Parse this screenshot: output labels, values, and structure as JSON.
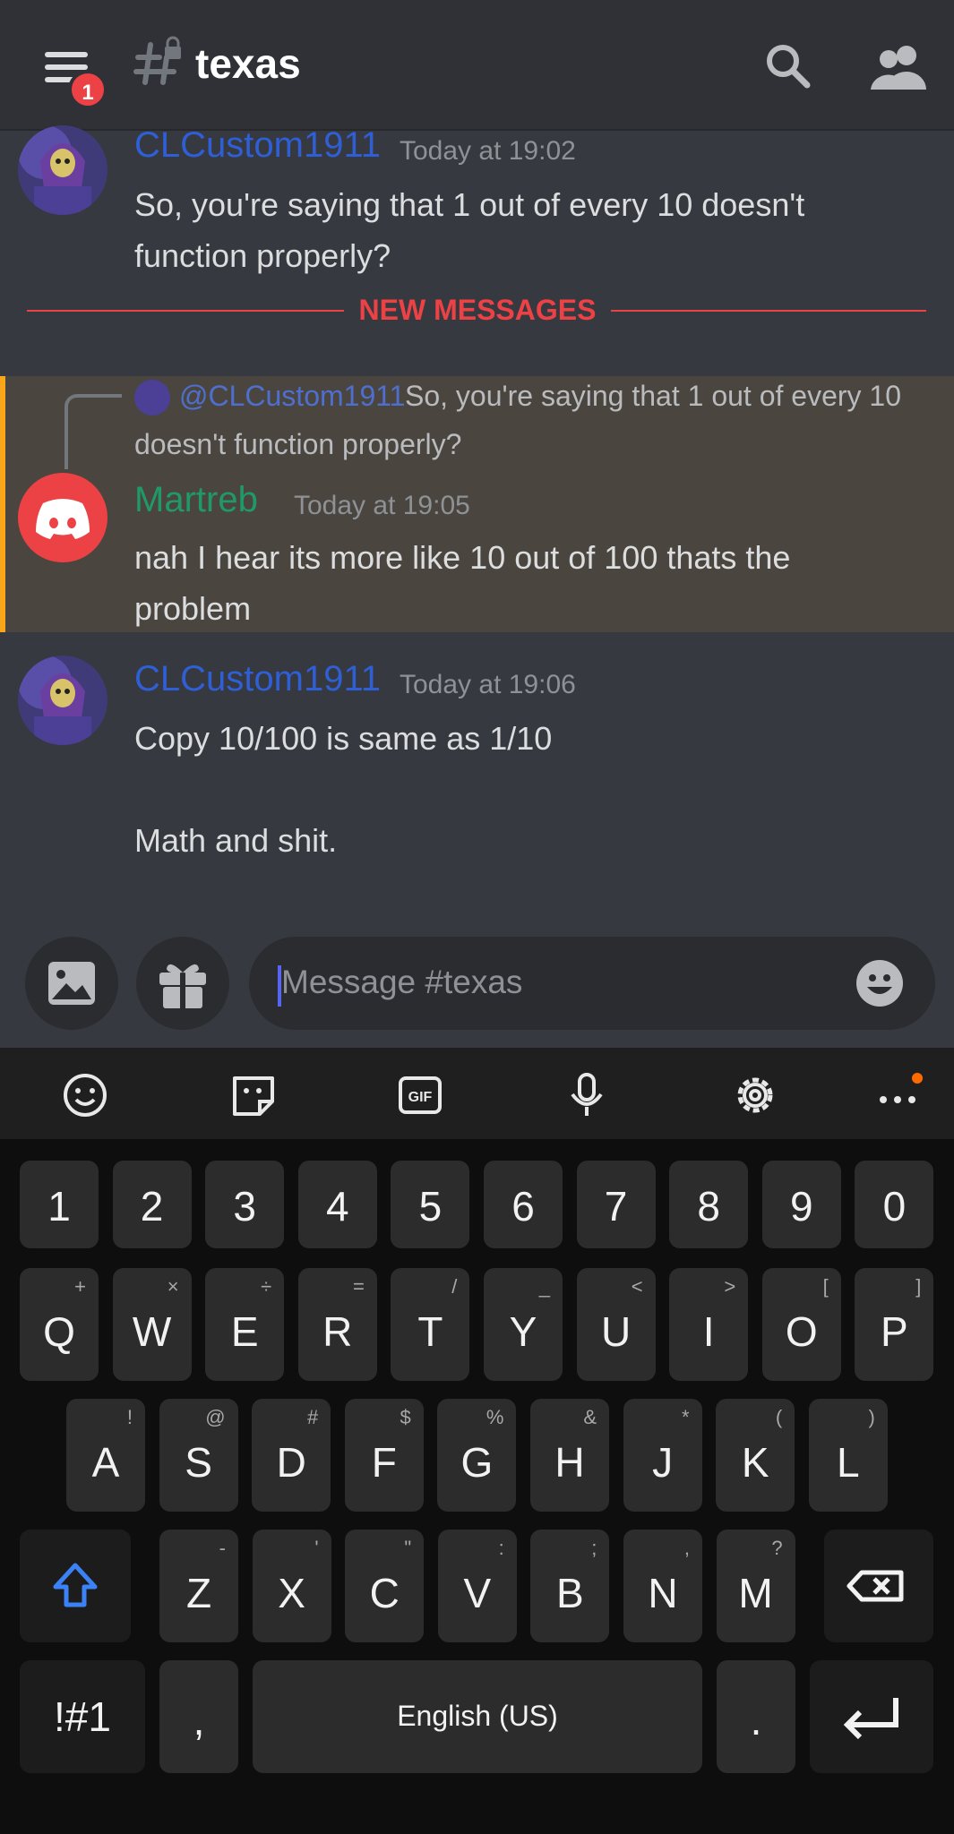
{
  "header": {
    "channel_name": "texas",
    "menu_badge": "1"
  },
  "messages": {
    "first": {
      "author": "CLCustom1911",
      "timestamp": "Today at 19:02",
      "lines": [
        "So, you're saying that 1 out of every 10 doesn't",
        "function properly?"
      ]
    },
    "divider_label": "NEW MESSAGES",
    "second": {
      "reply": {
        "mention": "@CLCustom1911",
        "text_line1": "So, you're saying that 1 out of every 10",
        "text_line2": "doesn't function properly?"
      },
      "author": "Martreb",
      "timestamp": "Today at 19:05",
      "lines": [
        "nah I hear its more like 10 out of 100 thats the",
        "problem"
      ]
    },
    "third": {
      "author": "CLCustom1911",
      "timestamp": "Today at 19:06",
      "line1": "Copy 10/100 is same as 1/10",
      "line2": "Math and shit."
    }
  },
  "composer": {
    "placeholder": "Message #texas"
  },
  "keyboard": {
    "numbers": [
      "1",
      "2",
      "3",
      "4",
      "5",
      "6",
      "7",
      "8",
      "9",
      "0"
    ],
    "row1": [
      {
        "k": "Q",
        "s": "+"
      },
      {
        "k": "W",
        "s": "×"
      },
      {
        "k": "E",
        "s": "÷"
      },
      {
        "k": "R",
        "s": "="
      },
      {
        "k": "T",
        "s": "/"
      },
      {
        "k": "Y",
        "s": "_"
      },
      {
        "k": "U",
        "s": "<"
      },
      {
        "k": "I",
        "s": ">"
      },
      {
        "k": "O",
        "s": "["
      },
      {
        "k": "P",
        "s": "]"
      }
    ],
    "row2": [
      {
        "k": "A",
        "s": "!"
      },
      {
        "k": "S",
        "s": "@"
      },
      {
        "k": "D",
        "s": "#"
      },
      {
        "k": "F",
        "s": "$"
      },
      {
        "k": "G",
        "s": "%"
      },
      {
        "k": "H",
        "s": "&"
      },
      {
        "k": "J",
        "s": "*"
      },
      {
        "k": "K",
        "s": "("
      },
      {
        "k": "L",
        "s": ")"
      }
    ],
    "row3": [
      {
        "k": "Z",
        "s": "-"
      },
      {
        "k": "X",
        "s": "'"
      },
      {
        "k": "C",
        "s": "\""
      },
      {
        "k": "V",
        "s": ":"
      },
      {
        "k": "B",
        "s": ";"
      },
      {
        "k": "N",
        "s": ","
      },
      {
        "k": "M",
        "s": "?"
      }
    ],
    "symbols_label": "!#1",
    "comma": ",",
    "space_label": "English (US)",
    "period": "."
  },
  "colors": {
    "accent_blue": "#5865f2",
    "username_blue": "#2f5fd6",
    "username_green": "#1f9a66",
    "new_messages_red": "#ed4245",
    "mention_bar": "#faa61a"
  }
}
